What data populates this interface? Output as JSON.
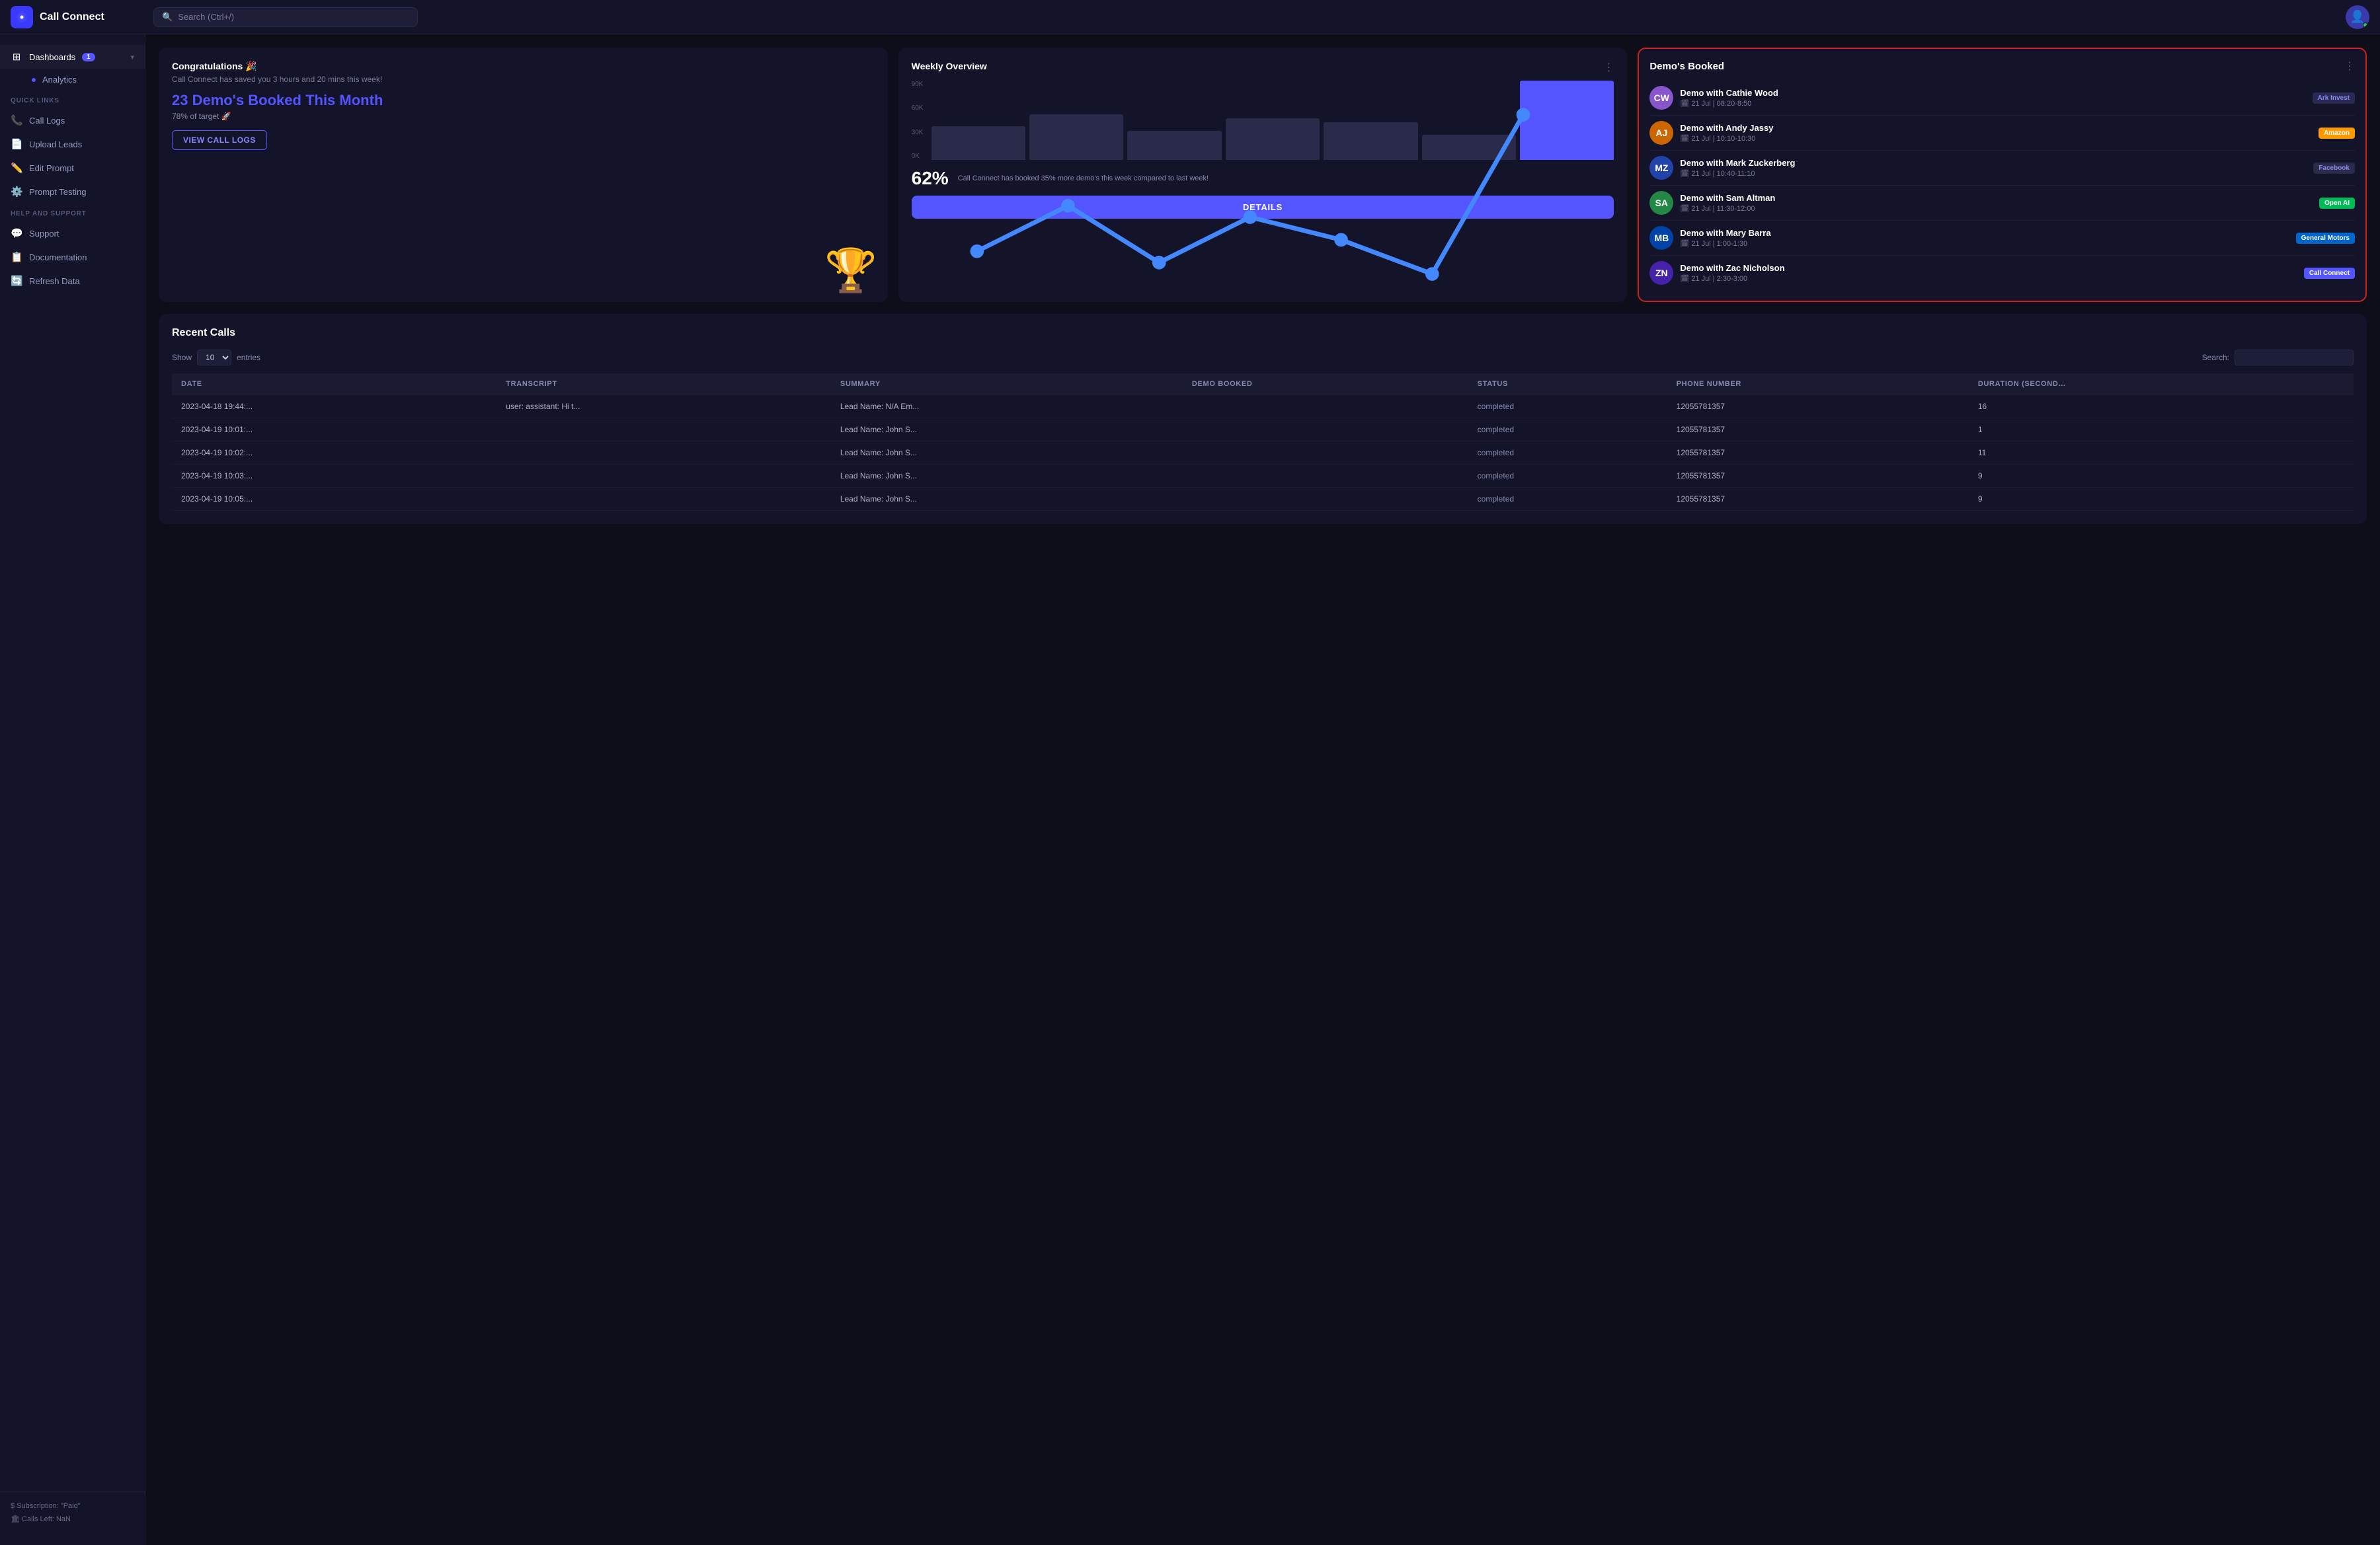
{
  "app": {
    "name": "Call Connect",
    "logo_emoji": "📞"
  },
  "topbar": {
    "search_placeholder": "Search (Ctrl+/)"
  },
  "sidebar": {
    "sections": [
      {
        "label": "",
        "items": [
          {
            "id": "dashboards",
            "label": "Dashboards",
            "icon": "⊞",
            "badge": "1",
            "active": true,
            "has_chevron": true
          },
          {
            "id": "analytics",
            "label": "Analytics",
            "icon": "●",
            "sub": true
          }
        ]
      },
      {
        "label": "Quick Links",
        "items": [
          {
            "id": "call-logs",
            "label": "Call Logs",
            "icon": "📞"
          },
          {
            "id": "upload-leads",
            "label": "Upload Leads",
            "icon": "📄"
          },
          {
            "id": "edit-prompt",
            "label": "Edit Prompt",
            "icon": "✏️"
          },
          {
            "id": "prompt-testing",
            "label": "Prompt Testing",
            "icon": "⚙️"
          }
        ]
      },
      {
        "label": "Help and Support",
        "items": [
          {
            "id": "support",
            "label": "Support",
            "icon": "💬"
          },
          {
            "id": "documentation",
            "label": "Documentation",
            "icon": "📋"
          },
          {
            "id": "refresh-data",
            "label": "Refresh Data",
            "icon": "🔄"
          }
        ]
      }
    ],
    "footer": {
      "subscription": "$ Subscription: \"Paid\"",
      "calls_left": "🏛 Calls Left: NaN"
    }
  },
  "congrats_card": {
    "title": "Congratulations 🎉",
    "subtitle": "Call Connect has saved you 3 hours and 20 mins this week!",
    "demos_count": "23 Demo's Booked This Month",
    "target_text": "78% of target 🚀",
    "btn_label": "VIEW CALL LOGS",
    "trophy": "🏆"
  },
  "weekly_overview": {
    "title": "Weekly Overview",
    "y_labels": [
      "90K",
      "60K",
      "30K",
      "0K"
    ],
    "percentage": "62%",
    "footer_text": "Call Connect has booked 35% more demo's this week compared to last week!",
    "btn_label": "DETAILS",
    "bars": [
      40,
      55,
      35,
      50,
      45,
      30,
      95
    ],
    "highlight_index": 6
  },
  "demos_booked": {
    "title": "Demo's Booked",
    "items": [
      {
        "name": "Demo with Cathie Wood",
        "time": "21 Jul | 08:20-8:50",
        "badge": "Ark Invest",
        "badge_class": "badge-ark",
        "color": "#8855cc",
        "initials": "CW"
      },
      {
        "name": "Demo with Andy Jassy",
        "time": "21 Jul | 10:10-10:30",
        "badge": "Amazon",
        "badge_class": "badge-amazon",
        "color": "#cc6600",
        "initials": "AJ"
      },
      {
        "name": "Demo with Mark Zuckerberg",
        "time": "21 Jul | 10:40-11:10",
        "badge": "Facebook",
        "badge_class": "badge-facebook",
        "color": "#2244aa",
        "initials": "MZ"
      },
      {
        "name": "Demo with Sam Altman",
        "time": "21 Jul | 11:30-12:00",
        "badge": "Open AI",
        "badge_class": "badge-openai",
        "color": "#228844",
        "initials": "SA"
      },
      {
        "name": "Demo with Mary Barra",
        "time": "21 Jul | 1:00-1:30",
        "badge": "General Motors",
        "badge_class": "badge-gm",
        "color": "#0044aa",
        "initials": "MB"
      },
      {
        "name": "Demo with Zac Nicholson",
        "time": "21 Jul | 2:30-3:00",
        "badge": "Call Connect",
        "badge_class": "badge-callconnect",
        "color": "#4422aa",
        "initials": "ZN"
      }
    ]
  },
  "recent_calls": {
    "title": "Recent Calls",
    "show_label": "Show",
    "show_value": "10",
    "entries_label": "entries",
    "search_label": "Search:",
    "columns": [
      "DATE",
      "TRANSCRIPT",
      "SUMMARY",
      "DEMO BOOKED",
      "STATUS",
      "PHONE NUMBER",
      "DURATION (SECOND…"
    ],
    "rows": [
      {
        "date": "2023-04-18 19:44:...",
        "transcript": "user: assistant: Hi t...",
        "summary": "Lead Name: N/A Em...",
        "demo_booked": "",
        "status": "completed",
        "phone": "12055781357",
        "duration": "16"
      },
      {
        "date": "2023-04-19 10:01:...",
        "transcript": "",
        "summary": "Lead Name: John S...",
        "demo_booked": "",
        "status": "completed",
        "phone": "12055781357",
        "duration": "1"
      },
      {
        "date": "2023-04-19 10:02:...",
        "transcript": "",
        "summary": "Lead Name: John S...",
        "demo_booked": "",
        "status": "completed",
        "phone": "12055781357",
        "duration": "11"
      },
      {
        "date": "2023-04-19 10:03:...",
        "transcript": "",
        "summary": "Lead Name: John S...",
        "demo_booked": "",
        "status": "completed",
        "phone": "12055781357",
        "duration": "9"
      },
      {
        "date": "2023-04-19 10:05:...",
        "transcript": "",
        "summary": "Lead Name: John S...",
        "demo_booked": "",
        "status": "completed",
        "phone": "12055781357",
        "duration": "9"
      }
    ]
  }
}
